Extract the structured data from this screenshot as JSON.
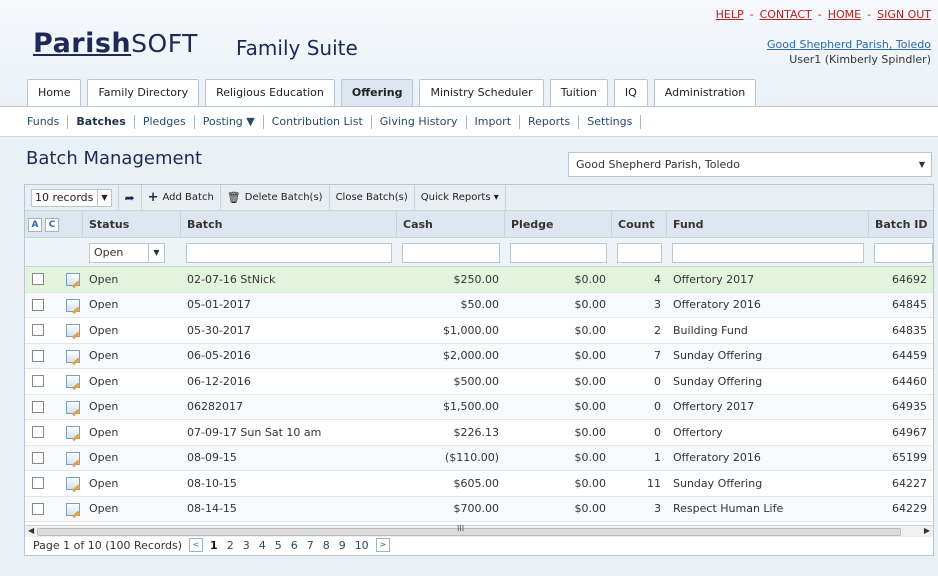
{
  "app": {
    "logo_main": "Parish",
    "logo_suffix": "SOFT",
    "suite_title": "Family Suite"
  },
  "toplinks": [
    "HELP",
    "CONTACT",
    "HOME",
    "SIGN OUT"
  ],
  "toplinks_sep": "-",
  "account": {
    "parish": "Good Shepherd Parish, Toledo",
    "user": "User1 (Kimberly Spindler)"
  },
  "tabs": [
    "Home",
    "Family Directory",
    "Religious Education",
    "Offering",
    "Ministry Scheduler",
    "Tuition",
    "IQ",
    "Administration"
  ],
  "active_tab": "Offering",
  "subnav": [
    "Funds",
    "Batches",
    "Pledges",
    "Posting ▼",
    "Contribution List",
    "Giving History",
    "Import",
    "Reports",
    "Settings"
  ],
  "page": {
    "title": "Batch Management",
    "parish_select": "Good Shepherd Parish, Toledo"
  },
  "toolbar": {
    "records": "10 records",
    "add": "Add Batch",
    "delete": "Delete Batch(s)",
    "close": "Close Batch(s)",
    "quick": "Quick Reports ▾"
  },
  "grid": {
    "ac_a": "A",
    "ac_c": "C",
    "columns": [
      "Status",
      "Batch",
      "Cash",
      "Pledge",
      "Count",
      "Fund",
      "Batch ID"
    ],
    "status_filter": "Open",
    "rows": [
      [
        "Open",
        "02-07-16 StNick",
        "$250.00",
        "$0.00",
        "4",
        "Offertory 2017",
        "64692"
      ],
      [
        "Open",
        "05-01-2017",
        "$50.00",
        "$0.00",
        "3",
        "Offeratory 2016",
        "64845"
      ],
      [
        "Open",
        "05-30-2017",
        "$1,000.00",
        "$0.00",
        "2",
        "Building Fund",
        "64835"
      ],
      [
        "Open",
        "06-05-2016",
        "$2,000.00",
        "$0.00",
        "7",
        "Sunday Offering",
        "64459"
      ],
      [
        "Open",
        "06-12-2016",
        "$500.00",
        "$0.00",
        "0",
        "Sunday Offering",
        "64460"
      ],
      [
        "Open",
        "06282017",
        "$1,500.00",
        "$0.00",
        "0",
        "Offertory 2017",
        "64935"
      ],
      [
        "Open",
        "07-09-17 Sun Sat 10 am",
        "$226.13",
        "$0.00",
        "0",
        "Offertory",
        "64967"
      ],
      [
        "Open",
        "08-09-15",
        "($110.00)",
        "$0.00",
        "1",
        "Offeratory 2016",
        "65199"
      ],
      [
        "Open",
        "08-10-15",
        "$605.00",
        "$0.00",
        "11",
        "Sunday Offering",
        "64227"
      ],
      [
        "Open",
        "08-14-15",
        "$700.00",
        "$0.00",
        "3",
        "Respect Human Life",
        "64229"
      ]
    ]
  },
  "pager": {
    "info": "Page 1 of 10 (100 Records)",
    "pages": [
      "1",
      "2",
      "3",
      "4",
      "5",
      "6",
      "7",
      "8",
      "9",
      "10"
    ],
    "current": "1",
    "prev": "<",
    "next": ">"
  }
}
